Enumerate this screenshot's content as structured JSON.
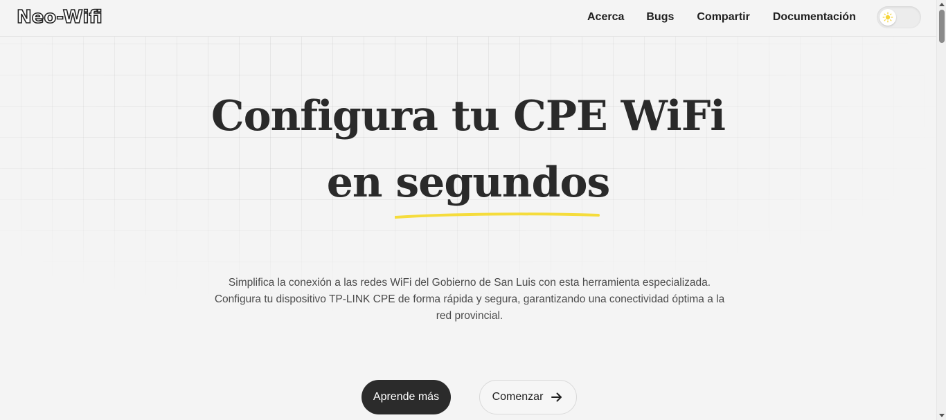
{
  "header": {
    "logo": "Neo-Wifi",
    "nav": [
      {
        "label": "Acerca"
      },
      {
        "label": "Bugs"
      },
      {
        "label": "Compartir"
      },
      {
        "label": "Documentación"
      }
    ],
    "theme_toggle": {
      "icon": "sun-icon",
      "state": "light"
    }
  },
  "hero": {
    "title_line1": "Configura tu CPE WiFi",
    "title_line2_prefix": "en",
    "title_line2_highlight": "segundos",
    "description": "Simplifica la conexión a las redes WiFi del Gobierno de San Luis con esta herramienta especializada. Configura tu dispositivo TP-LINK CPE de forma rápida y segura, garantizando una conectividad óptima a la red provincial.",
    "primary_button": "Aprende más",
    "secondary_button": "Comenzar",
    "secondary_button_icon": "arrow-right-icon"
  },
  "colors": {
    "background": "#f4f4f4",
    "text": "#2a2a2a",
    "accent_underline": "#f5dc3c",
    "primary_button_bg": "#2b2b2b"
  }
}
